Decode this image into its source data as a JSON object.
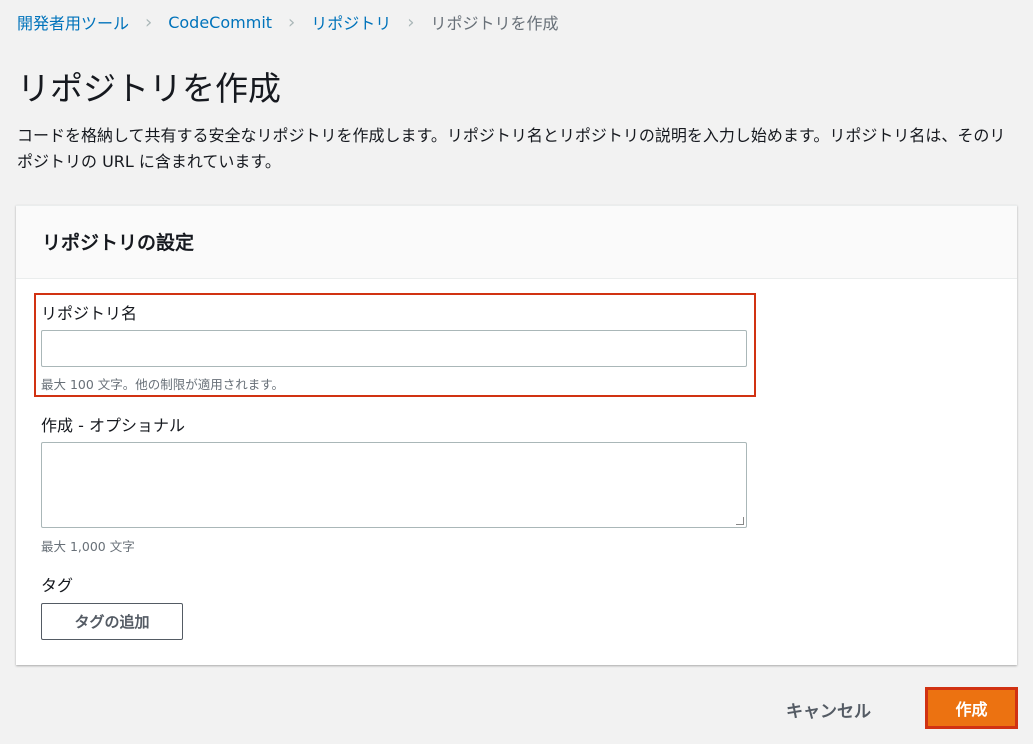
{
  "breadcrumb": [
    "開発者用ツール",
    "CodeCommit",
    "リポジトリ",
    "リポジトリを作成"
  ],
  "title": "リポジトリを作成",
  "description": "コードを格納して共有する安全なリポジトリを作成します。リポジトリ名とリポジトリの説明を入力し始めます。リポジトリ名は、そのリポジトリの URL に含まれています。",
  "panel": {
    "title": "リポジトリの設定",
    "name_label": "リポジトリ名",
    "name_value": "",
    "name_hint": "最大 100 文字。他の制限が適用されます。",
    "desc_label": "作成 - オプショナル",
    "desc_value": "",
    "desc_hint": "最大 1,000 文字",
    "tags_label": "タグ",
    "add_tag": "タグの追加"
  },
  "actions": {
    "cancel": "キャンセル",
    "create": "作成"
  }
}
